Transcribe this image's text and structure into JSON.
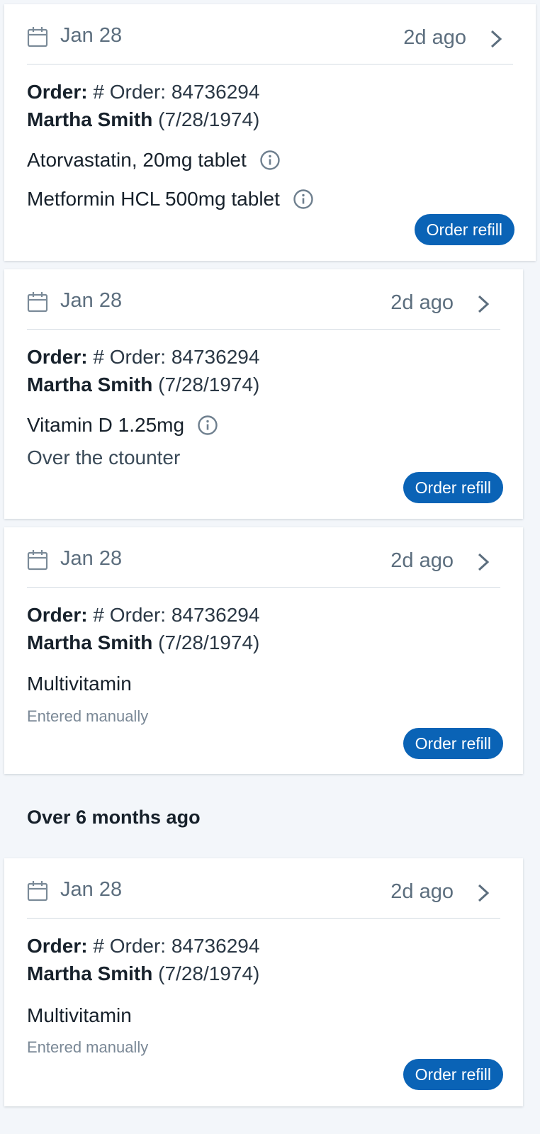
{
  "cards": [
    {
      "date": "Jan 28",
      "ago": "2d ago",
      "order_label": "Order:",
      "order_value": "# Order: 84736294",
      "patient_name": "Martha Smith",
      "patient_dob": "(7/28/1974)",
      "meds": [
        "Atorvastatin, 20mg tablet",
        "Metformin HCL 500mg tablet"
      ],
      "button_label": "Order refill"
    },
    {
      "date": "Jan 28",
      "ago": "2d ago",
      "order_label": "Order:",
      "order_value": "# Order: 84736294",
      "patient_name": "Martha Smith",
      "patient_dob": "(7/28/1974)",
      "meds": [
        "Vitamin D 1.25mg"
      ],
      "note": "Over the ctounter",
      "button_label": "Order refill"
    },
    {
      "date": "Jan 28",
      "ago": "2d ago",
      "order_label": "Order:",
      "order_value": "# Order: 84736294",
      "patient_name": "Martha Smith",
      "patient_dob": "(7/28/1974)",
      "meds": [
        "Multivitamin"
      ],
      "note": "Entered manually",
      "button_label": "Order refill"
    },
    {
      "date": "Jan 28",
      "ago": "2d ago",
      "order_label": "Order:",
      "order_value": "# Order: 84736294",
      "patient_name": "Martha Smith",
      "patient_dob": "(7/28/1974)",
      "meds": [
        "Multivitamin"
      ],
      "note": "Entered manually",
      "button_label": "Order refill"
    }
  ],
  "section": {
    "title": "Over 6 months ago"
  },
  "icons": {
    "date": "calendar-icon",
    "open": "chevron-right-icon",
    "details": "info-icon"
  },
  "colors": {
    "accent": "#0a63b6",
    "background": "#f3f6fa"
  }
}
